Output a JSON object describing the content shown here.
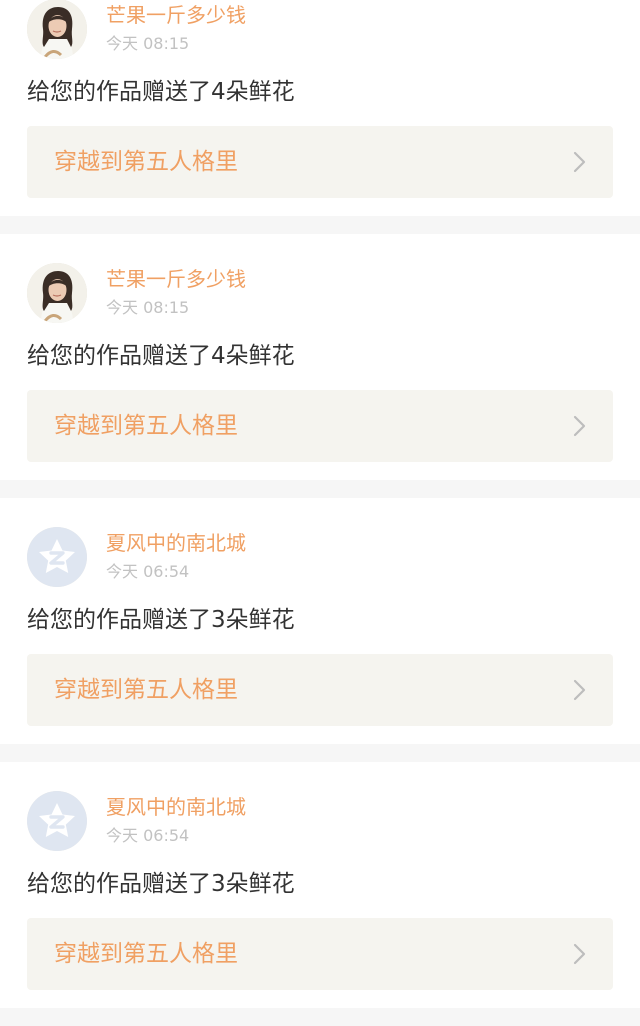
{
  "notifications": [
    {
      "avatar": "photo-avatar-icon",
      "username": "芒果一斤多少钱",
      "time": "今天 08:15",
      "message": "给您的作品赠送了4朵鲜花",
      "work_title": "穿越到第五人格里"
    },
    {
      "avatar": "photo-avatar-icon",
      "username": "芒果一斤多少钱",
      "time": "今天 08:15",
      "message": "给您的作品赠送了4朵鲜花",
      "work_title": "穿越到第五人格里"
    },
    {
      "avatar": "default-avatar-icon",
      "username": "夏风中的南北城",
      "time": "今天 06:54",
      "message": "给您的作品赠送了3朵鲜花",
      "work_title": "穿越到第五人格里"
    },
    {
      "avatar": "default-avatar-icon",
      "username": "夏风中的南北城",
      "time": "今天 06:54",
      "message": "给您的作品赠送了3朵鲜花",
      "work_title": "穿越到第五人格里"
    }
  ],
  "colors": {
    "accent": "#f0a063",
    "muted_text": "#c2c2c2",
    "body_text": "#333333",
    "link_background": "#f5f4ef",
    "chevron": "#bdbdbd",
    "default_avatar": "#dfe6f1"
  }
}
